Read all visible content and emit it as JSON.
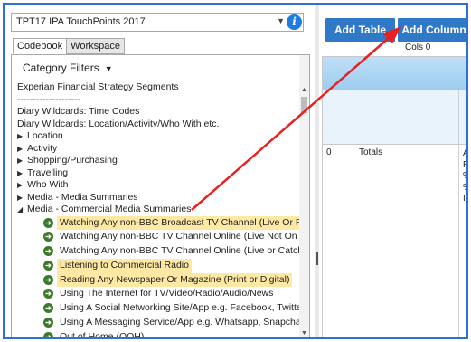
{
  "dataset": {
    "selected": "TPT17 IPA TouchPoints 2017"
  },
  "tabs": [
    {
      "label": "Codebook"
    },
    {
      "label": "Workspace"
    }
  ],
  "category_filters": {
    "label": "Category Filters"
  },
  "tree": {
    "top": [
      "Experian Financial Strategy Segments",
      "--------------------",
      "Diary Wildcards: Time Codes",
      "Diary Wildcards: Location/Activity/Who With etc."
    ],
    "collapsed": [
      "Location",
      "Activity",
      "Shopping/Purchasing",
      "Travelling",
      "Who With",
      "Media - Media Summaries"
    ],
    "expanded": "Media - Commercial Media Summaries",
    "children": [
      {
        "label": "Watching Any non-BBC Broadcast TV Channel (Live Or Re",
        "highlighted": true
      },
      {
        "label": "Watching Any non-BBC TV Channel Online (Live Not On T",
        "highlighted": false
      },
      {
        "label": "Watching Any non-BBC TV Channel Online (Live or Catch-",
        "highlighted": false
      },
      {
        "label": "Listening to Commercial Radio",
        "highlighted": true
      },
      {
        "label": "Reading Any Newspaper Or Magazine (Print or Digital)",
        "highlighted": true
      },
      {
        "label": "Using The Internet for TV/Video/Radio/Audio/News",
        "highlighted": false
      },
      {
        "label": "Using A Social Networking Site/App e.g. Facebook, Twitte",
        "highlighted": false
      },
      {
        "label": "Using A Messaging Service/App e.g. Whatsapp, Snapchat",
        "highlighted": false
      },
      {
        "label": "Out of Home (OOH)",
        "highlighted": false
      }
    ]
  },
  "toolbar": {
    "add_table": "Add Table",
    "add_column": "Add Column",
    "cols": "Cols 0"
  },
  "grid": {
    "row_num": "0",
    "row_label": "Totals",
    "metrics": [
      "Au",
      "Re",
      "%",
      "%",
      "In"
    ]
  },
  "colors": {
    "button": "#2f79c8",
    "highlight": "#fde8a4",
    "annotation_arrow": "#e8201f",
    "frame": "#2f6fd6"
  }
}
